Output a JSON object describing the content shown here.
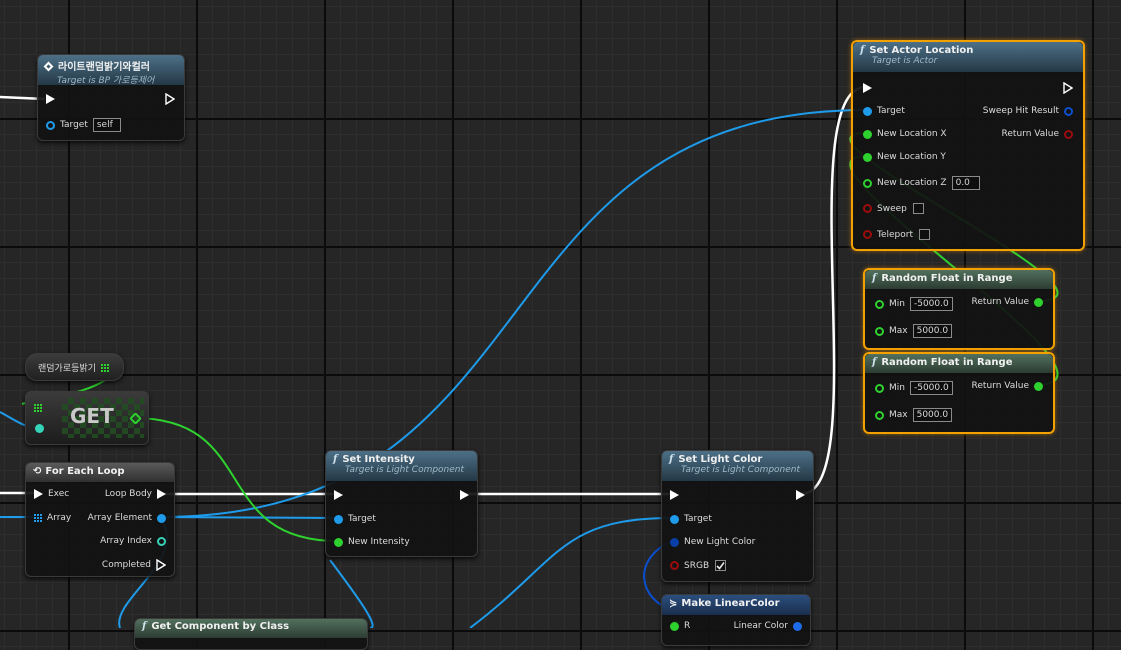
{
  "canvas": {
    "background": "#262626",
    "wire_colors": {
      "exec": "#ffffff",
      "object": "#1e9bea",
      "float": "#2ed12e"
    }
  },
  "nodes": {
    "event": {
      "title": "라이트랜덤밝기와컬러",
      "subtitle": "Target is BP 가로등제어",
      "target_label": "Target",
      "target_value": "self"
    },
    "variable": {
      "label": "랜덤가로등밝기"
    },
    "get_node": {
      "label": "GET"
    },
    "for_each": {
      "title": "For Each Loop",
      "pins": {
        "exec": "Exec",
        "array": "Array",
        "loop_body": "Loop Body",
        "array_element": "Array Element",
        "array_index": "Array Index",
        "completed": "Completed"
      }
    },
    "get_component": {
      "title": "Get Component by Class"
    },
    "set_intensity": {
      "title": "Set Intensity",
      "subtitle": "Target is Light Component",
      "pins": {
        "target": "Target",
        "new_intensity": "New Intensity"
      }
    },
    "set_light_color": {
      "title": "Set Light Color",
      "subtitle": "Target is Light Component",
      "pins": {
        "target": "Target",
        "new_light_color": "New Light Color",
        "srgb": "SRGB"
      },
      "srgb_checked": true
    },
    "make_linear_color": {
      "title": "Make LinearColor",
      "pins": {
        "r": "R",
        "linear_color": "Linear Color"
      }
    },
    "set_actor_location": {
      "title": "Set Actor Location",
      "subtitle": "Target is Actor",
      "pins": {
        "target": "Target",
        "new_location_x": "New Location X",
        "new_location_y": "New Location Y",
        "new_location_z": "New Location Z",
        "new_location_z_value": "0.0",
        "sweep": "Sweep",
        "teleport": "Teleport",
        "sweep_hit_result": "Sweep Hit Result",
        "return_value": "Return Value"
      }
    },
    "random_float_1": {
      "title": "Random Float in Range",
      "min_label": "Min",
      "min_value": "-5000.0",
      "max_label": "Max",
      "max_value": "5000.0",
      "return_label": "Return Value"
    },
    "random_float_2": {
      "title": "Random Float in Range",
      "min_label": "Min",
      "min_value": "-5000.0",
      "max_label": "Max",
      "max_value": "5000.0",
      "return_label": "Return Value"
    }
  }
}
